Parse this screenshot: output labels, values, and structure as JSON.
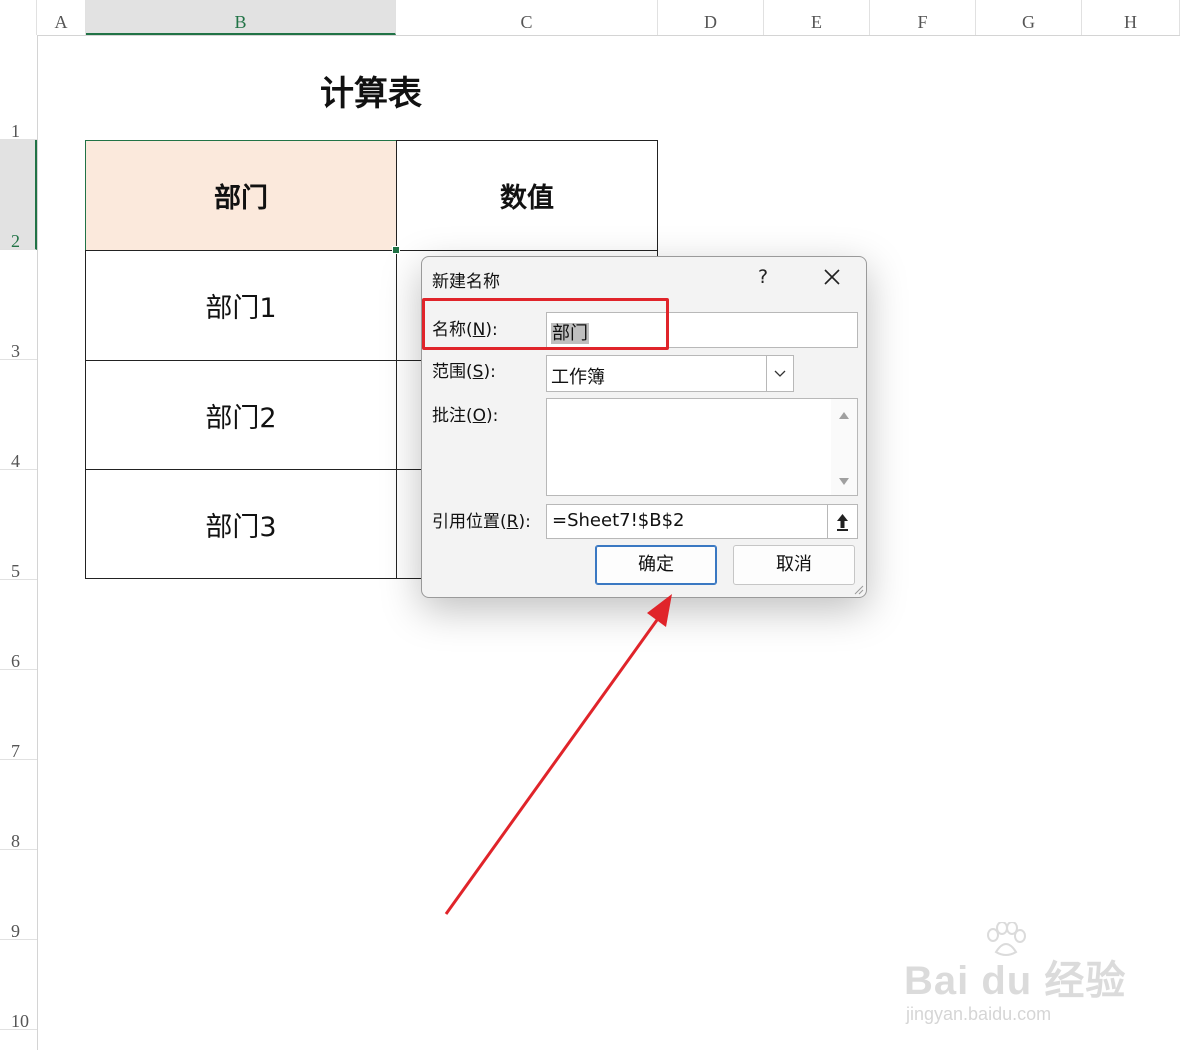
{
  "columns": [
    "A",
    "B",
    "C",
    "D",
    "E",
    "F",
    "G",
    "H"
  ],
  "rows": [
    "1",
    "2",
    "3",
    "4",
    "5",
    "6",
    "7",
    "8",
    "9",
    "10"
  ],
  "sheet": {
    "title": "计算表",
    "header": [
      "部门",
      "数值"
    ],
    "rows": [
      "部门1",
      "部门2",
      "部门3"
    ]
  },
  "dialog": {
    "title": "新建名称",
    "help": "?",
    "close": "✕",
    "name_label": "名称(",
    "name_key": "N",
    "name_suffix": "):",
    "name_value": "部门",
    "scope_label": "范围(",
    "scope_key": "S",
    "scope_suffix": "):",
    "scope_value": "工作簿",
    "comment_label": "批注(",
    "comment_key": "O",
    "comment_suffix": "):",
    "ref_label": "引用位置(",
    "ref_key": "R",
    "ref_suffix": "):",
    "ref_value": "=Sheet7!$B$2",
    "ok": "确定",
    "cancel": "取消"
  },
  "watermark": {
    "brand": "Bai du 经验",
    "url": "jingyan.baidu.com"
  },
  "colors": {
    "accent": "#217346",
    "selected_fill": "#fbe9dc",
    "annotation": "#e0242a"
  }
}
